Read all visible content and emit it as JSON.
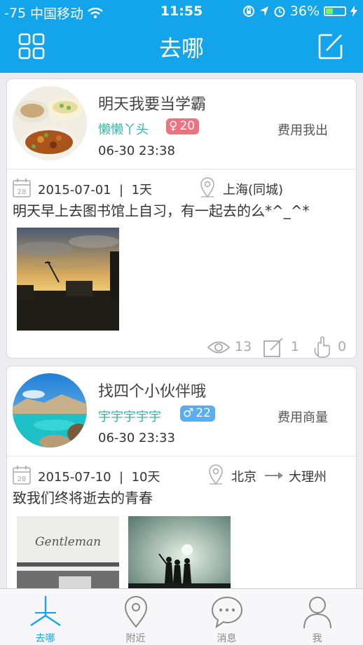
{
  "status_bar": {
    "signal": "-75",
    "carrier": "中国移动",
    "time": "11:55",
    "battery": "36%"
  },
  "nav": {
    "title": "去哪",
    "left_icon": "grid-icon",
    "right_icon": "compose-icon"
  },
  "posts": [
    {
      "title": "明天我要当学霸",
      "user": "懒懒丫头",
      "gender": "♀",
      "age": "20",
      "cost": "费用我出",
      "time": "06-30 23:38",
      "date": "2015-07-01",
      "duration": "1天",
      "location": "上海(同城)",
      "description": "明天早上去图书馆上自习，有一起去的么*^_^*",
      "views": "13",
      "comments": "1",
      "likes": "0"
    },
    {
      "title": "找四个小伙伴哦",
      "user": "宇宇宇宇宇",
      "gender": "♂",
      "age": "22",
      "cost": "费用商量",
      "time": "06-30 23:33",
      "date": "2015-07-10",
      "duration": "10天",
      "from": "北京",
      "to": "大理州",
      "description": "致我们终将逝去的青春",
      "photo_caption": "Gentleman"
    }
  ],
  "tabs": [
    {
      "label": "去哪",
      "icon": "compass-icon",
      "active": true
    },
    {
      "label": "附近",
      "icon": "location-pin-icon"
    },
    {
      "label": "消息",
      "icon": "chat-bubble-icon"
    },
    {
      "label": "我",
      "icon": "person-icon"
    }
  ],
  "colors": {
    "brand": "#13a5ec",
    "username": "#2fb9a3",
    "female": "#f0717f",
    "male": "#5aaef0"
  }
}
